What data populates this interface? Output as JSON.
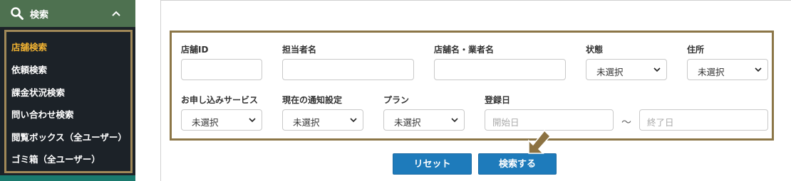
{
  "sidebar": {
    "header_title": "検索",
    "items": [
      {
        "label": "店舗検索",
        "active": true
      },
      {
        "label": "依頼検索",
        "active": false
      },
      {
        "label": "課金状況検索",
        "active": false
      },
      {
        "label": "問い合わせ検索",
        "active": false
      },
      {
        "label": "閲覧ボックス（全ユーザー）",
        "active": false
      },
      {
        "label": "ゴミ箱（全ユーザー）",
        "active": false
      }
    ],
    "colors": {
      "header_bg": "#4e7150",
      "bg": "#1c2228",
      "active_text": "#f0b232",
      "highlight_border": "#a08858"
    }
  },
  "form": {
    "labels": {
      "store_id": "店舗ID",
      "staff_name": "担当者名",
      "store_vendor_name": "店舗名・業者名",
      "status": "状態",
      "address": "住所",
      "service": "お申し込みサービス",
      "notification": "現在の通知設定",
      "plan": "プラン",
      "registered_date": "登録日"
    },
    "selects": {
      "status": "未選択",
      "address": "未選択",
      "service": "未選択",
      "notification": "未選択",
      "plan": "未選択"
    },
    "date_start_placeholder": "開始日",
    "date_end_placeholder": "終了日",
    "range_separator": "～"
  },
  "buttons": {
    "reset": "リセット",
    "search": "検索する"
  },
  "icons": [
    "search-icon",
    "chevron-up-icon",
    "chevron-down-icon",
    "pointer-arrow-icon"
  ],
  "colors": {
    "button_bg": "#1e7bbb",
    "form_highlight_border": "#8c7647"
  }
}
